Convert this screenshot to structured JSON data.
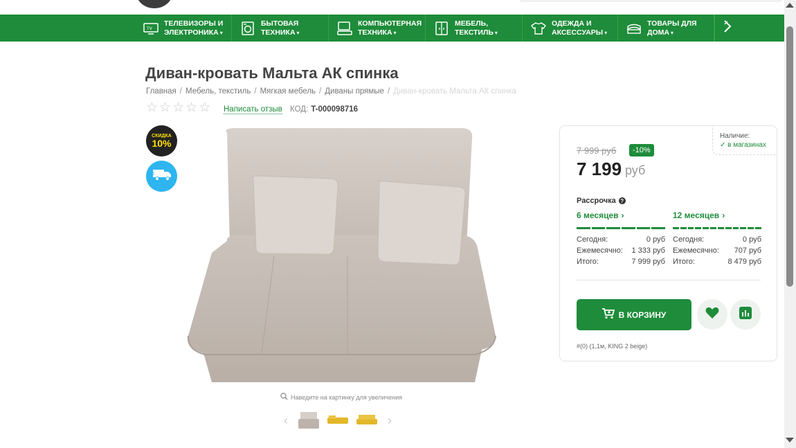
{
  "nav": {
    "items": [
      {
        "line1": "Телевизоры и",
        "line2": "электроника",
        "icon": "tv-icon"
      },
      {
        "line1": "Бытовая",
        "line2": "техника",
        "icon": "washing-machine-icon"
      },
      {
        "line1": "Компьютерная",
        "line2": "техника",
        "icon": "computer-icon"
      },
      {
        "line1": "Мебель,",
        "line2": "текстиль",
        "icon": "wardrobe-icon"
      },
      {
        "line1": "Одежда и",
        "line2": "аксессуары",
        "icon": "tshirt-icon"
      },
      {
        "line1": "Товары для",
        "line2": "дома",
        "icon": "towels-icon"
      }
    ],
    "more_icon": "chevron-right-icon"
  },
  "product": {
    "title": "Диван-кровать Мальта АК спинка",
    "breadcrumbs": [
      "Главная",
      "Мебель, текстиль",
      "Мягкая мебель",
      "Диваны прямые",
      "Диван-кровать Мальта АК спинка"
    ],
    "rating_stars": 0,
    "review_link": "Написать отзыв",
    "code_label": "КОД:",
    "code_value": "T-000098716",
    "discount_badge_small": "СКИДКА",
    "discount_badge_big": "10%",
    "zoom_hint": "Наведите на картинку для увеличения"
  },
  "card": {
    "availability_label": "Наличие:",
    "availability_value": "✓ в магазинах",
    "old_price": "7 999 руб",
    "discount": "-10%",
    "price": "7 199",
    "currency": "руб",
    "installment_title": "Рассрочка",
    "plans": [
      {
        "title": "6 месяцев",
        "rows": [
          [
            "Сегодня:",
            "0 руб"
          ],
          [
            "Ежемесячно:",
            "1 333 руб"
          ],
          [
            "Итого:",
            "7 999 руб"
          ]
        ]
      },
      {
        "title": "12 месяцев",
        "rows": [
          [
            "Сегодня:",
            "0 руб"
          ],
          [
            "Ежемесячно:",
            "707 руб"
          ],
          [
            "Итого:",
            "8 479 руб"
          ]
        ]
      }
    ],
    "cart_button": "В КОРЗИНУ",
    "sku": "#(0) (1,1м, KING 2 beige)"
  },
  "colors": {
    "brand_green": "#1e8c3a",
    "badge_blue": "#2eb5f0",
    "badge_yellow": "#ffe000"
  }
}
